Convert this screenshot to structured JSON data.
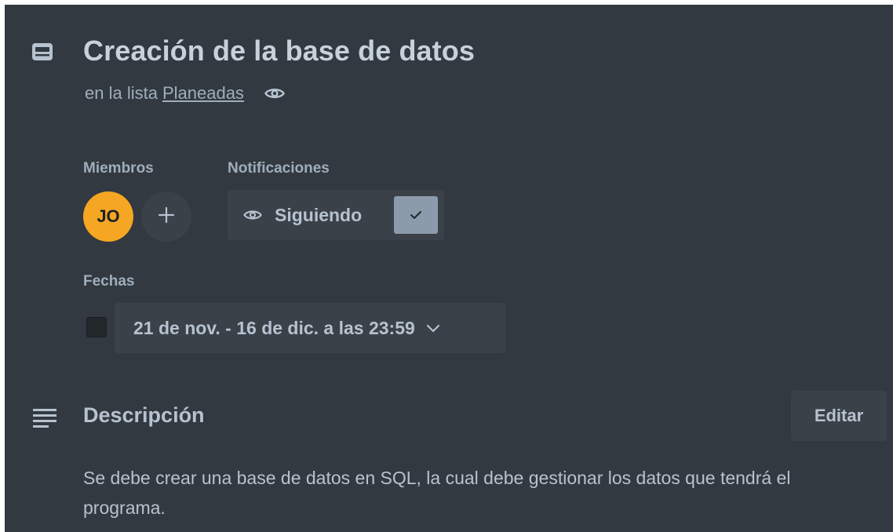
{
  "card": {
    "title": "Creación de la base de datos",
    "list_prefix": "en la lista",
    "list_name": "Planeadas"
  },
  "members": {
    "label": "Miembros",
    "avatar_initials": "JO",
    "avatar_color": "#f5a623"
  },
  "notifications": {
    "label": "Notificaciones",
    "watch_label": "Siguiendo"
  },
  "dates": {
    "label": "Fechas",
    "range": "21 de nov. - 16 de dic. a las 23:59"
  },
  "description": {
    "title": "Descripción",
    "edit_label": "Editar",
    "text": "Se debe crear una base de datos en SQL, la cual debe gestionar los datos que tendrá el programa."
  },
  "icons": {
    "card": "card-icon",
    "watch": "eye-icon",
    "add": "plus-icon",
    "check": "check-icon",
    "chevron": "chevron-down-icon",
    "description": "description-lines-icon"
  },
  "colors": {
    "background": "#323940",
    "button": "#3a4149",
    "text": "#b6c2cf",
    "check_bg": "#8c9bab"
  }
}
